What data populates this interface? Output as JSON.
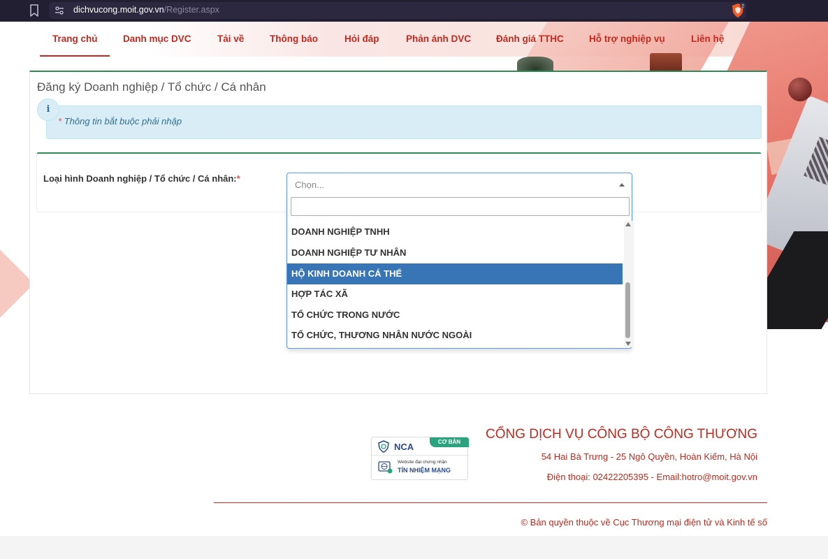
{
  "browser": {
    "url_host": "dichvucong.moit.gov.vn",
    "url_path": "/Register.aspx"
  },
  "nav": {
    "items": [
      {
        "label": "Trang chủ",
        "active": true
      },
      {
        "label": "Danh mục DVC"
      },
      {
        "label": "Tải về"
      },
      {
        "label": "Thông báo"
      },
      {
        "label": "Hỏi đáp"
      },
      {
        "label": "Phản ánh DVC"
      },
      {
        "label": "Đánh giá TTHC"
      },
      {
        "label": "Hỗ trợ nghiệp vụ"
      },
      {
        "label": "Liên hệ"
      }
    ]
  },
  "page": {
    "title": "Đăng ký Doanh nghiệp / Tổ chức / Cá nhân",
    "info_star": "*",
    "info_text": "Thông tin bắt buộc phải nhập",
    "info_icon": "i"
  },
  "form": {
    "label": "Loại hình Doanh nghiệp / Tổ chức / Cá nhân:",
    "required_mark": "*",
    "select_placeholder": "Chọn...",
    "search_value": "",
    "options": [
      {
        "label": "DOANH NGHIỆP TNHH",
        "selected": false
      },
      {
        "label": "DOANH NGHIỆP TƯ NHÂN",
        "selected": false
      },
      {
        "label": "HỘ KINH DOANH CÁ THỂ",
        "selected": true
      },
      {
        "label": "HỢP TÁC XÃ",
        "selected": false
      },
      {
        "label": "TỔ CHỨC TRONG NƯỚC",
        "selected": false
      },
      {
        "label": "TỔ CHỨC, THƯƠNG NHÂN NƯỚC NGOÀI",
        "selected": false
      }
    ]
  },
  "badge": {
    "brand": "NCA",
    "tier": "CƠ BẢN",
    "certified": "Website đạt chứng nhận",
    "trust": "TÍN NHIỆM MẠNG"
  },
  "footer": {
    "portal_name": "CỔNG DỊCH VỤ CÔNG BỘ CÔNG THƯƠNG",
    "address": "54 Hai Bà Trưng - 25 Ngô Quyền, Hoàn Kiếm, Hà Nội",
    "phone": "Điện thoại: 02422205395 - Email:hotro@moit.gov.vn",
    "copyright": "© Bản quyền thuộc về Cục Thương mại điện tử và Kinh tế số"
  },
  "colors": {
    "brand_red": "#c22a1f",
    "accent_green": "#2e8b57",
    "selected_option": "#3875b7",
    "info_bg": "#d9edf7"
  }
}
